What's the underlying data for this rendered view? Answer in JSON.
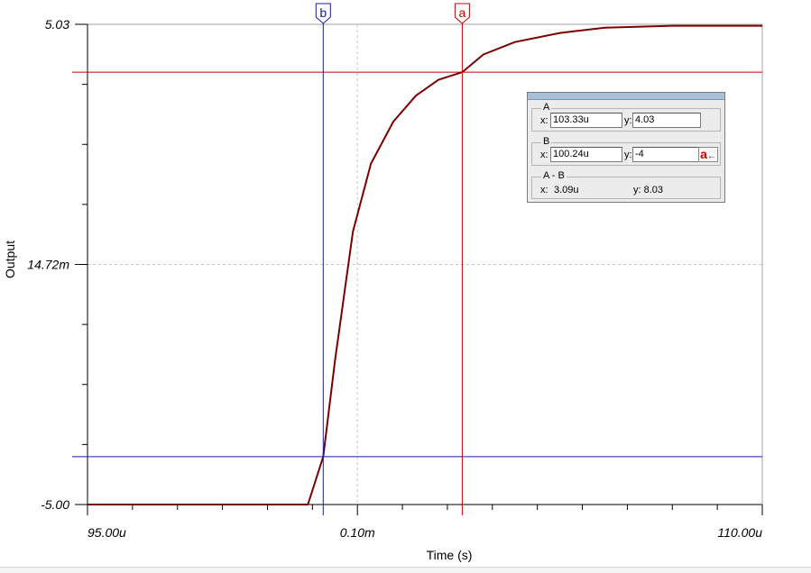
{
  "chart_data": {
    "type": "line",
    "xlabel": "Time (s)",
    "ylabel": "Output",
    "x_tick_labels": [
      {
        "value": 95.0,
        "label": "95.00u"
      },
      {
        "value": 101.0,
        "label": "0.10m"
      },
      {
        "value": 110.0,
        "label": "110.00u"
      }
    ],
    "y_tick_labels": [
      {
        "value": -5.0,
        "label": "-5.00"
      },
      {
        "value": 0.01472,
        "label": "14.72m"
      },
      {
        "value": 5.03,
        "label": "5.03"
      }
    ],
    "xlim": [
      95.0,
      110.0
    ],
    "ylim": [
      -5.0,
      5.03
    ],
    "x_units": "us",
    "grid": "dashed gray at labeled ticks",
    "series": [
      {
        "color": "#7a0000",
        "x": [
          95.0,
          99.9,
          100.24,
          100.5,
          100.9,
          101.3,
          101.8,
          102.3,
          102.8,
          103.33,
          103.8,
          104.5,
          105.5,
          106.5,
          108.0,
          110.0
        ],
        "y": [
          -5.0,
          -5.0,
          -4.0,
          -2.0,
          0.7,
          2.12,
          3.0,
          3.54,
          3.87,
          4.03,
          4.4,
          4.66,
          4.85,
          4.96,
          5.0,
          5.0
        ]
      }
    ],
    "cursors": [
      {
        "name": "b",
        "x": 100.24,
        "y": -4.0,
        "color": "#1a1aa0"
      },
      {
        "name": "a",
        "x": 103.33,
        "y": 4.03,
        "color": "#c00000"
      }
    ]
  },
  "readout": {
    "group_a_title": "A",
    "a_x_label": "x:",
    "a_x_value": "103.33u",
    "a_y_label": "y:",
    "a_y_value": "4.03",
    "group_b_title": "B",
    "b_x_label": "x:",
    "b_x_value": "100.24u",
    "b_y_label": "y:",
    "b_y_value": "-4",
    "swap_label": "a",
    "swap_arrow": "←",
    "group_diff_title": "A - B",
    "diff_x_label": "x:",
    "diff_x_value": "3.09u",
    "diff_y_text": "y: 8.03"
  }
}
